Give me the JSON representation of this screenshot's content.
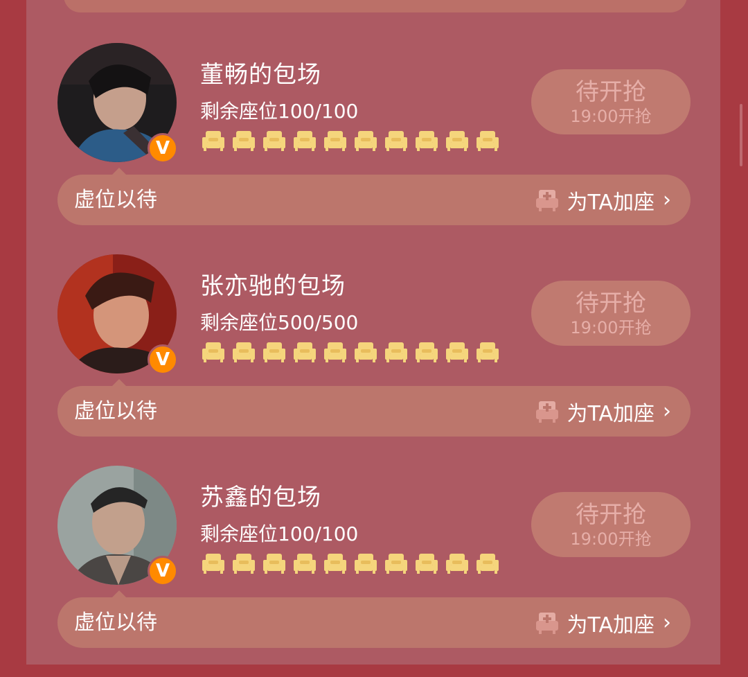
{
  "colors": {
    "background": "#a83a42",
    "panel": "#ad5a63",
    "bar": "#bc766c",
    "badge": "#ff8a00",
    "seat": "#f5d57c"
  },
  "sessions": [
    {
      "title": "董畅的包场",
      "seats_label": "剩余座位100/100",
      "seat_icon_count": 10,
      "button_main": "待开抢",
      "button_sub": "19:00开抢",
      "placeholder": "虚位以待",
      "add_seat_label": "为TA加座",
      "badge": "V"
    },
    {
      "title": "张亦驰的包场",
      "seats_label": "剩余座位500/500",
      "seat_icon_count": 10,
      "button_main": "待开抢",
      "button_sub": "19:00开抢",
      "placeholder": "虚位以待",
      "add_seat_label": "为TA加座",
      "badge": "V"
    },
    {
      "title": "苏鑫的包场",
      "seats_label": "剩余座位100/100",
      "seat_icon_count": 10,
      "button_main": "待开抢",
      "button_sub": "19:00开抢",
      "placeholder": "虚位以待",
      "add_seat_label": "为TA加座",
      "badge": "V"
    }
  ],
  "icons": {
    "seat": "armchair-icon",
    "add": "add-seat-icon",
    "chevron": "chevron-right-icon",
    "badge": "verified-v-icon"
  }
}
